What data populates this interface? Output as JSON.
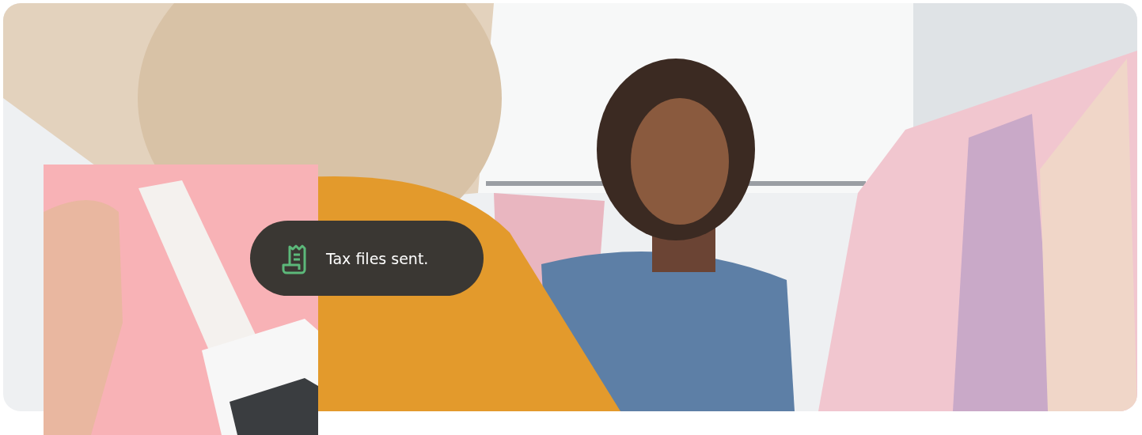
{
  "toast": {
    "text": "Tax files sent."
  }
}
